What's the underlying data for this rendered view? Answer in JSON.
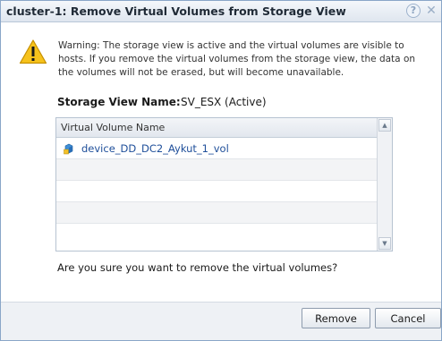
{
  "dialog": {
    "title": "cluster-1: Remove Virtual Volumes from Storage View",
    "help_glyph": "?",
    "close_glyph": "✕"
  },
  "warning": {
    "icon": "warning-triangle-icon",
    "text": "Warning: The storage view is active and the virtual volumes are visible to hosts. If you remove the virtual volumes from the storage view, the data on the volumes will not be erased, but will become unavailable."
  },
  "storage_view": {
    "label": "Storage View Name:",
    "value": "SV_ESX (Active)"
  },
  "table": {
    "column_header": "Virtual Volume Name",
    "rows": [
      {
        "name": "device_DD_DC2_Aykut_1_vol",
        "icon": "virtual-volume-icon"
      },
      {
        "name": ""
      },
      {
        "name": ""
      },
      {
        "name": ""
      },
      {
        "name": ""
      }
    ]
  },
  "question": "Are you sure you want to remove the virtual volumes?",
  "buttons": {
    "remove": "Remove",
    "cancel": "Cancel"
  },
  "colors": {
    "title_bar": "#dfe6ef",
    "link_text": "#1f4f9a",
    "warning_fill": "#f6c21c"
  }
}
